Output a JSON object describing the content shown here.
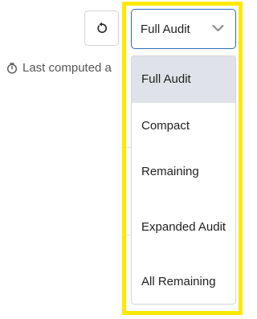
{
  "refresh_button": {
    "icon": "refresh-icon"
  },
  "last_computed": {
    "icon": "clock-icon",
    "text": "Last computed a"
  },
  "view_select": {
    "value": "Full Audit",
    "icon": "chevron-down-icon",
    "accent_color": "#2b6cb0"
  },
  "highlight": {
    "color": "#ffe800"
  },
  "menu": {
    "items": [
      {
        "label": "Full Audit",
        "selected": true
      },
      {
        "label": "Compact",
        "selected": false
      },
      {
        "label": "Remaining",
        "selected": false
      },
      {
        "label": "Expanded Audit",
        "selected": false
      },
      {
        "label": "All Remaining",
        "selected": false
      }
    ]
  }
}
